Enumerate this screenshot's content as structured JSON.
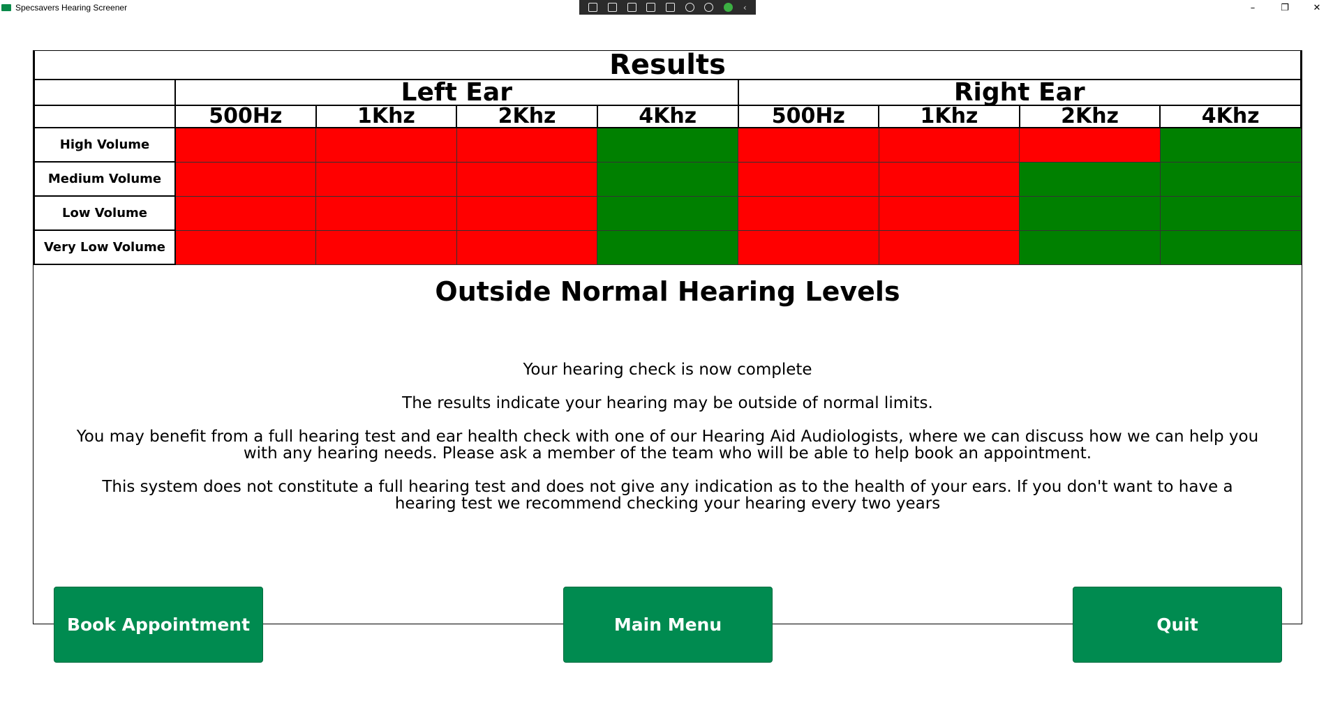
{
  "window": {
    "title": "Specsavers Hearing Screener",
    "minimize": "–",
    "restore": "❐",
    "close": "✕"
  },
  "results": {
    "title": "Results",
    "left_ear": "Left Ear",
    "right_ear": "Right Ear",
    "frequencies": [
      "500Hz",
      "1Khz",
      "2Khz",
      "4Khz",
      "500Hz",
      "1Khz",
      "2Khz",
      "4Khz"
    ],
    "rows": [
      {
        "label": "High Volume",
        "cells": [
          "fail",
          "fail",
          "fail",
          "pass",
          "fail",
          "fail",
          "fail",
          "pass"
        ]
      },
      {
        "label": "Medium Volume",
        "cells": [
          "fail",
          "fail",
          "fail",
          "pass",
          "fail",
          "fail",
          "pass",
          "pass"
        ]
      },
      {
        "label": "Low Volume",
        "cells": [
          "fail",
          "fail",
          "fail",
          "pass",
          "fail",
          "fail",
          "pass",
          "pass"
        ]
      },
      {
        "label": "Very Low Volume",
        "cells": [
          "fail",
          "fail",
          "fail",
          "pass",
          "fail",
          "fail",
          "pass",
          "pass"
        ]
      }
    ],
    "colors": {
      "fail": "#ff0000",
      "pass": "#008000"
    }
  },
  "outcome": {
    "heading": "Outside Normal Hearing Levels",
    "line1": "Your hearing check is now complete",
    "line2": "The results indicate your hearing may be outside of normal limits.",
    "line3": "You may benefit from a full hearing test and ear health check with one of our Hearing Aid Audiologists, where we can discuss how we can help you with any hearing needs. Please ask a member of the team who will be able to help book an appointment.",
    "line4": "This system does not constitute a full hearing test and does not give any indication as to the health of your ears. If you don't want to have a hearing test we recommend checking your hearing every two years"
  },
  "buttons": {
    "book": "Book Appointment",
    "menu": "Main Menu",
    "quit": "Quit"
  },
  "theme": {
    "button_green": "#008b50"
  }
}
